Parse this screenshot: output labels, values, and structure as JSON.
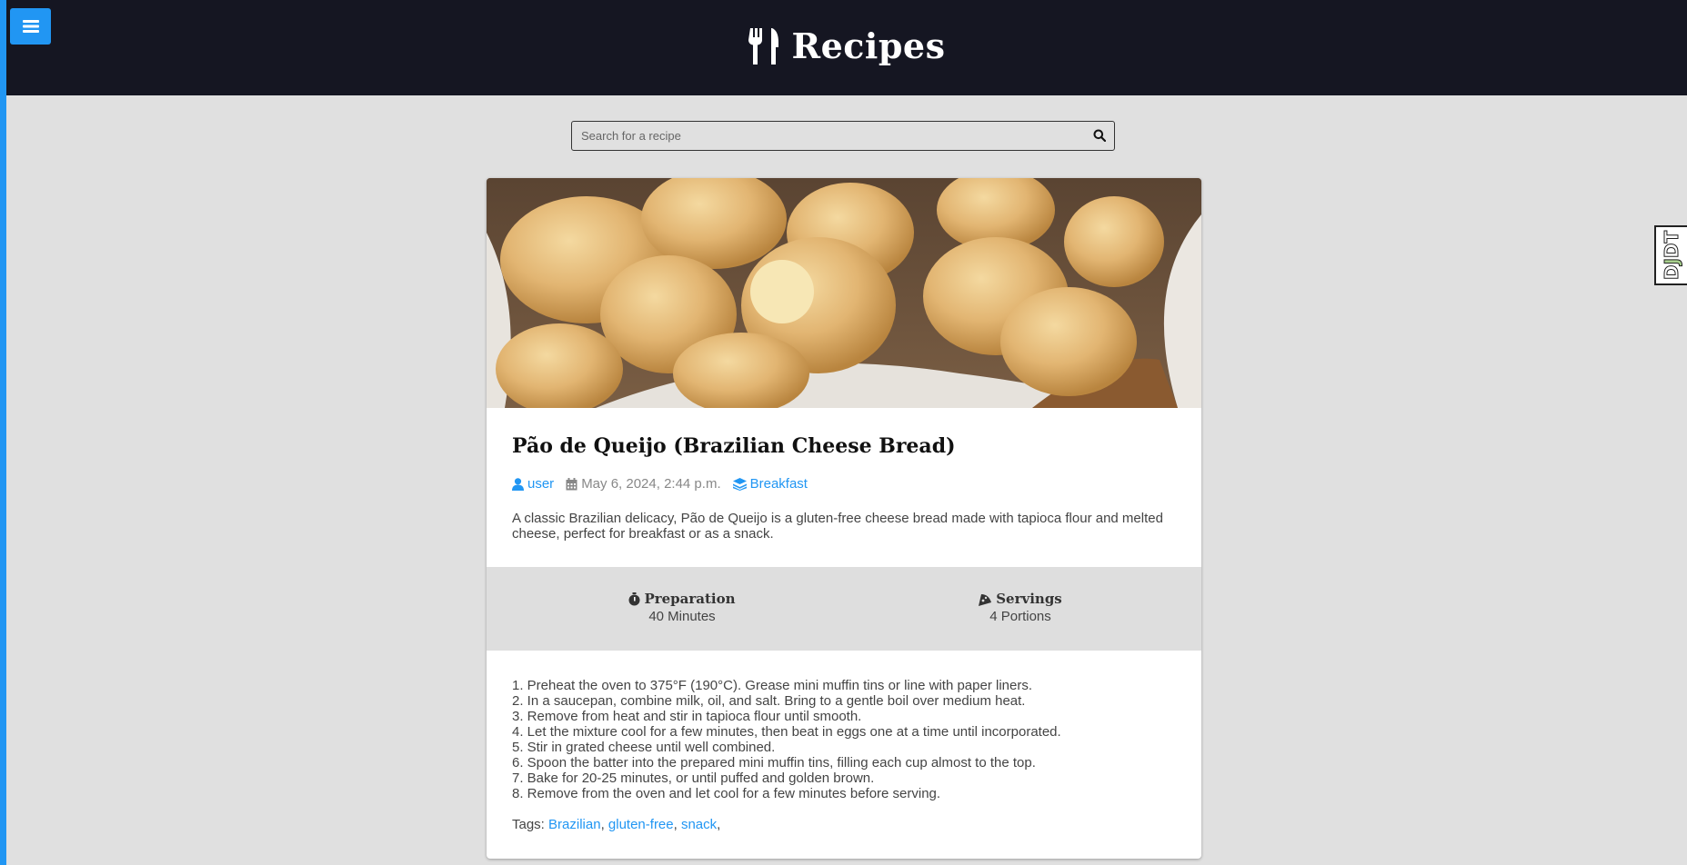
{
  "header": {
    "brand_icon": "utensils-icon",
    "title": "Recipes",
    "menu_icon": "hamburger-menu-icon"
  },
  "search": {
    "placeholder": "Search for a recipe",
    "icon": "magnifier-icon"
  },
  "recipe": {
    "image_alt": "Pão de Queijo",
    "title": "Pão de Queijo (Brazilian Cheese Bread)",
    "author": "user",
    "date": "May 6, 2024, 2:44 p.m.",
    "category": "Breakfast",
    "description": "A classic Brazilian delicacy, Pão de Queijo is a gluten-free cheese bread made with tapioca flour and melted cheese, perfect for breakfast or as a snack.",
    "stats": {
      "preparation_label": "Preparation",
      "preparation_value": "40 Minutes",
      "servings_label": "Servings",
      "servings_value": "4 Portions"
    },
    "steps": [
      "1. Preheat the oven to 375°F (190°C). Grease mini muffin tins or line with paper liners.",
      "2. In a saucepan, combine milk, oil, and salt. Bring to a gentle boil over medium heat.",
      "3. Remove from heat and stir in tapioca flour until smooth.",
      "4. Let the mixture cool for a few minutes, then beat in eggs one at a time until incorporated.",
      "5. Stir in grated cheese until well combined.",
      "6. Spoon the batter into the prepared mini muffin tins, filling each cup almost to the top.",
      "7. Bake for 20-25 minutes, or until puffed and golden brown.",
      "8. Remove from the oven and let cool for a few minutes before serving."
    ],
    "tags_label": "Tags:",
    "tags": [
      "Brazilian",
      "gluten-free",
      "snack"
    ]
  },
  "debug_toolbar": {
    "label_d": "D",
    "label_j": "J",
    "label_dt": "DT"
  },
  "colors": {
    "accent": "#2196f3",
    "header_bg": "#151622",
    "page_bg": "#e0e0e0"
  }
}
